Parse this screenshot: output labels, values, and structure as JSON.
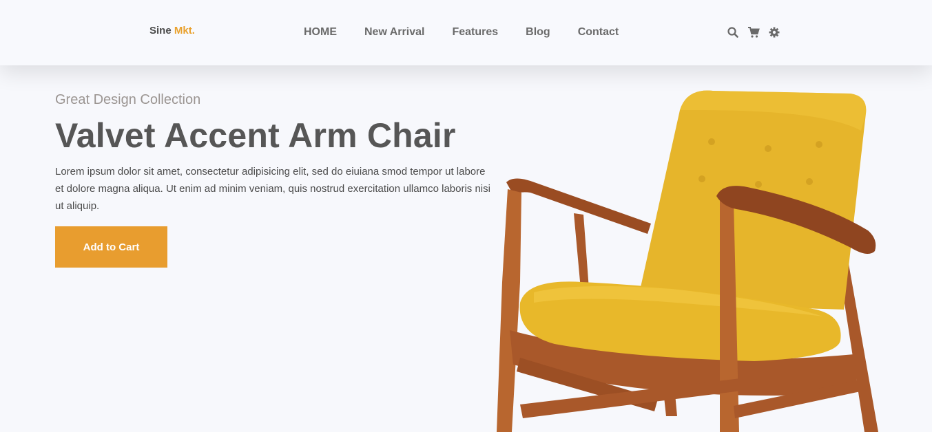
{
  "brand": {
    "name": "Sine",
    "accent": "Mkt.",
    "accent_color": "#e9a12d"
  },
  "nav": {
    "items": [
      {
        "label": "HOME"
      },
      {
        "label": "New Arrival"
      },
      {
        "label": "Features"
      },
      {
        "label": "Blog"
      },
      {
        "label": "Contact"
      }
    ]
  },
  "header_icons": [
    "search-icon",
    "cart-icon",
    "gear-icon"
  ],
  "hero": {
    "subtitle": "Great Design Collection",
    "title": "Valvet Accent Arm Chair",
    "description": "Lorem ipsum dolor sit amet, consectetur adipisicing elit, sed do eiuiana smod tempor ut labore et dolore magna aliqua. Ut enim ad minim veniam, quis nostrud exercitation ullamco laboris nisi ut aliquip.",
    "cta_label": "Add to Cart",
    "cta_color": "#e89d2f"
  },
  "colors": {
    "background": "#f7f8fc",
    "chair_fabric": "#e8b82a",
    "chair_wood": "#b0602e"
  }
}
